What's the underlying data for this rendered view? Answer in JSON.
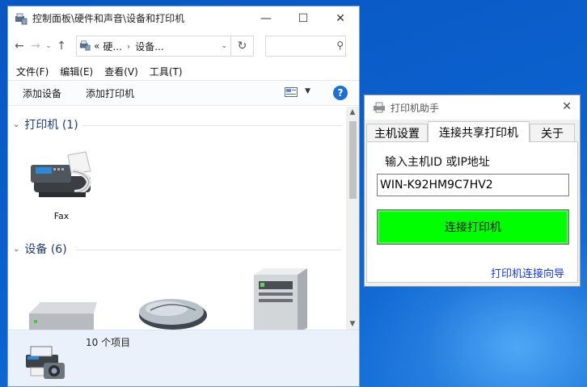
{
  "explorer": {
    "title": "控制面板\\硬件和声音\\设备和打印机",
    "address_overflow": "«",
    "address_crumbs": [
      "硬...",
      "设备..."
    ],
    "menu": [
      "文件(F)",
      "编辑(E)",
      "查看(V)",
      "工具(T)"
    ],
    "commands": [
      "添加设备",
      "添加打印机"
    ],
    "groups": [
      {
        "label": "打印机 (1)"
      },
      {
        "label": "设备 (6)"
      }
    ],
    "printers": [
      {
        "label": "Fax",
        "icon": "fax-icon"
      }
    ],
    "devices": [
      {
        "label": "",
        "icon": "drive-icon"
      },
      {
        "label": "",
        "icon": "mouse-icon"
      },
      {
        "label": "",
        "icon": "computer-tower-icon"
      }
    ],
    "status_count": "10 个项目",
    "accent_color": "#1e3a78"
  },
  "helper": {
    "title": "打印机助手",
    "tabs": [
      "主机设置",
      "连接共享打印机",
      "关于"
    ],
    "active_tab": 1,
    "field_label": "输入主机ID 或IP地址",
    "host_value": "WIN-K92HM9C7HV2",
    "connect_label": "连接打印机",
    "wizard_link": "打印机连接向导",
    "connect_color": "#00ff00",
    "link_color": "#1535d6"
  }
}
